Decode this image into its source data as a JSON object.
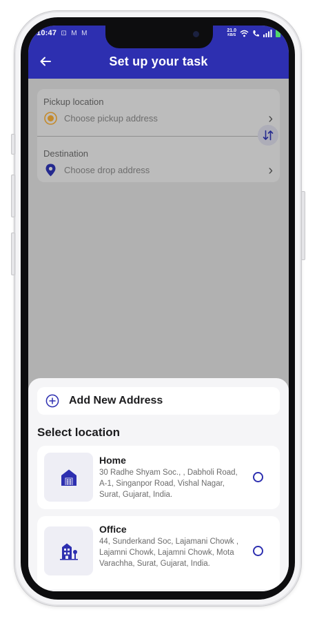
{
  "status_bar": {
    "time": "10:47",
    "notification_icons": [
      "instagram-icon",
      "gmail-icon",
      "gmail-icon"
    ],
    "speed_value": "21.0",
    "speed_unit": "KB/S"
  },
  "header": {
    "title": "Set up your task",
    "color": "#2d2fb0"
  },
  "route": {
    "pickup_label": "Pickup location",
    "pickup_placeholder": "Choose pickup address",
    "destination_label": "Destination",
    "destination_placeholder": "Choose drop address"
  },
  "sheet": {
    "add_address_label": "Add New Address",
    "section_title": "Select location",
    "addresses": [
      {
        "name": "Home",
        "address": "30 Radhe Shyam Soc., , Dabholi Road, A-1, Singanpor Road, Vishal Nagar, Surat, Gujarat, India.",
        "icon": "home-icon",
        "selected": false
      },
      {
        "name": "Office",
        "address": "44, Sunderkand Soc, Lajamani Chowk , Lajamni Chowk, Lajamni Chowk, Mota Varachha, Surat, Gujarat, India.",
        "icon": "office-icon",
        "selected": false
      }
    ]
  }
}
